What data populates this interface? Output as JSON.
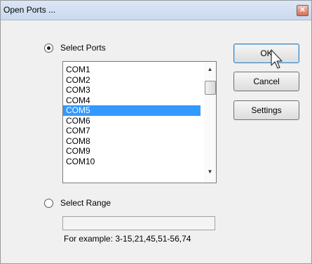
{
  "window": {
    "title": "Open Ports ...",
    "close_icon": "close-icon"
  },
  "select_ports": {
    "label": "Select Ports",
    "checked": true
  },
  "port_list": {
    "items": [
      "COM1",
      "COM2",
      "COM3",
      "COM4",
      "COM5",
      "COM6",
      "COM7",
      "COM8",
      "COM9",
      "COM10"
    ],
    "selected": "COM5"
  },
  "buttons": {
    "ok": "OK",
    "cancel": "Cancel",
    "settings": "Settings"
  },
  "select_range": {
    "label": "Select Range",
    "checked": false,
    "value": "",
    "example": "For example: 3-15,21,45,51-56,74"
  },
  "colors": {
    "selection": "#3399ff",
    "title_bar": "#dce7f5",
    "close_button": "#d66e56"
  }
}
